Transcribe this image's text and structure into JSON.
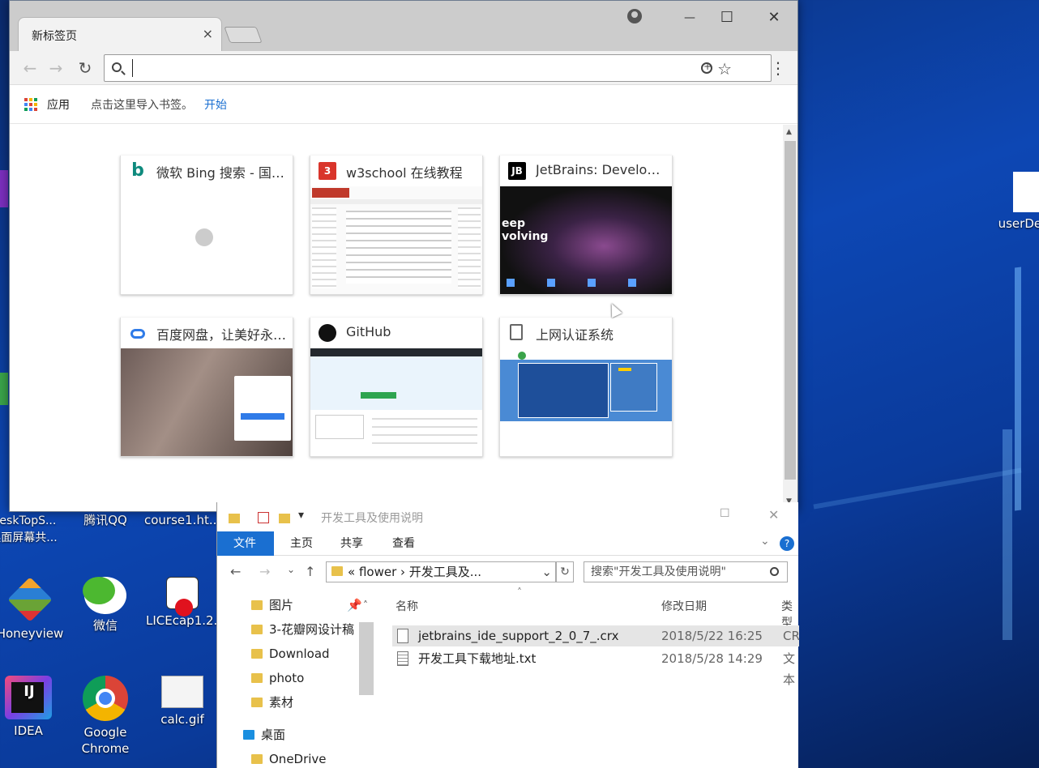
{
  "colors": {
    "chrome_bg": "#cccccc",
    "accent": "#1a6fd1",
    "desktop": "#0d47b4"
  },
  "chrome": {
    "tab_title": "新标签页",
    "tab_close": "×",
    "controls": {
      "minimize": "—",
      "maximize": "☐",
      "close": "✕"
    },
    "omnibox_placeholder": "",
    "bookmarks": {
      "apps_label": "应用",
      "import_text": "点击这里导入书签。",
      "start_link": "开始"
    },
    "tiles": [
      {
        "title": "微软 Bing 搜索 - 国…",
        "icon": "bing-icon",
        "icon_color": "#0e8a7d",
        "icon_char": "b"
      },
      {
        "title": "w3school 在线教程",
        "icon": "w3school-icon",
        "icon_color": "#d9352b",
        "icon_char": "3"
      },
      {
        "title": "JetBrains: Develope…",
        "icon": "jetbrains-icon",
        "icon_color": "#000000",
        "icon_char": "JB"
      },
      {
        "title": "百度网盘，让美好永…",
        "icon": "baidu-netdisk-icon",
        "icon_color": "#2f7be8",
        "icon_char": ""
      },
      {
        "title": "GitHub",
        "icon": "github-icon",
        "icon_color": "#111111",
        "icon_char": ""
      },
      {
        "title": "上网认证系统",
        "icon": "page-icon",
        "icon_color": "#ffffff",
        "icon_char": ""
      }
    ]
  },
  "desktop": {
    "icons": [
      {
        "label": "DeskTopS... 桌面屏幕共...",
        "icon": "desktop-share-icon"
      },
      {
        "label": "腾讯QQ",
        "icon": "qq-icon"
      },
      {
        "label": "course1.ht...",
        "icon": "chrome-html-icon"
      },
      {
        "label": "Honeyview",
        "icon": "honeyview-icon"
      },
      {
        "label": "微信",
        "icon": "wechat-icon"
      },
      {
        "label": "LICEcap1.2...",
        "icon": "licecap-icon"
      },
      {
        "label": "IDEA",
        "icon": "idea-icon"
      },
      {
        "label": "Google Chrome",
        "icon": "chrome-icon"
      },
      {
        "label": "calc.gif",
        "icon": "gif-file-icon"
      },
      {
        "label": "userDef",
        "icon": "file-icon"
      }
    ]
  },
  "explorer": {
    "title": "开发工具及使用说明",
    "ribbon": [
      "文件",
      "主页",
      "共享",
      "查看"
    ],
    "path": "«  flower  ›   开发工具及...",
    "search_placeholder": "搜索\"开发工具及使用说明\"",
    "tree": [
      "图片",
      "3-花瓣网设计稿",
      "Download",
      "photo",
      "素材",
      "桌面",
      "OneDrive"
    ],
    "columns": {
      "name": "名称",
      "date": "修改日期",
      "type": "类型"
    },
    "files": [
      {
        "name": "jetbrains_ide_support_2_0_7_.crx",
        "date": "2018/5/22 16:25",
        "type": "CR"
      },
      {
        "name": "开发工具下载地址.txt",
        "date": "2018/5/28 14:29",
        "type": "文本"
      }
    ]
  }
}
